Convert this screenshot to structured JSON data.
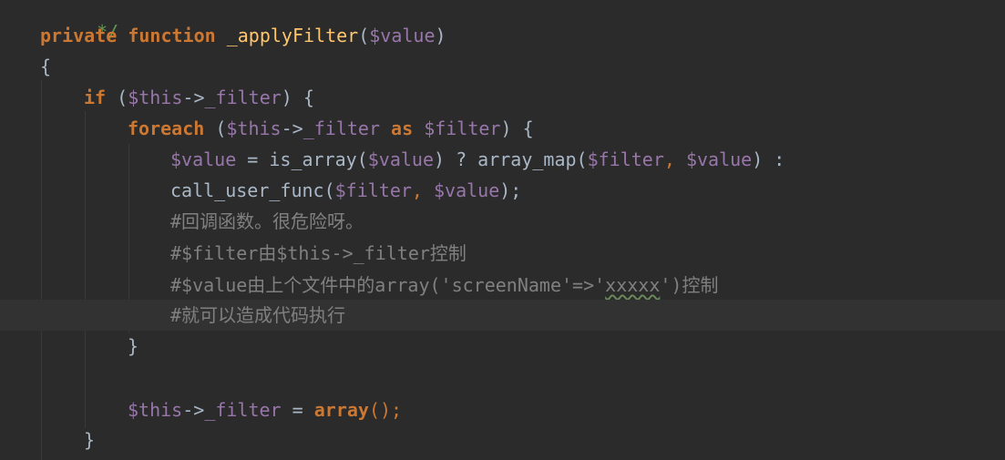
{
  "code": {
    "line0_doc_end": "*/",
    "line1": {
      "kw_private": "private",
      "kw_function": "function",
      "fn_name": "_applyFilter",
      "paren_open": "(",
      "param": "$value",
      "paren_close": ")"
    },
    "line2_brace": "{",
    "line3": {
      "kw_if": "if",
      "p1": "(",
      "this": "$this",
      "arrow": "->",
      "prop": "_filter",
      "p2": ") {"
    },
    "line4": {
      "kw_foreach": "foreach",
      "p1": "(",
      "this": "$this",
      "arrow": "->",
      "prop": "_filter",
      "kw_as": "as",
      "var": "$filter",
      "p2": ") {"
    },
    "line5": {
      "var1": "$value",
      "eq": " = is_array(",
      "var2": "$value",
      "mid": ") ? array_map(",
      "var3": "$filter",
      "comma": ", ",
      "var4": "$value",
      "end": ") :"
    },
    "line6": {
      "fn": "call_user_func(",
      "var1": "$filter",
      "comma": ", ",
      "var2": "$value",
      "end": ");"
    },
    "line7_comment": "#回调函数。很危险呀。",
    "line8_comment": "#$filter由$this->_filter控制",
    "line9": {
      "c1": "#$value由上个文件中的array('screenName'=>'",
      "squiggly": "xxxxx",
      "c2": "')控制"
    },
    "line10_comment": "#就可以造成代码执行",
    "line11_brace": "}",
    "line13": {
      "this": "$this",
      "arrow": "->",
      "prop": "_filter",
      "eq": " = ",
      "kw_array": "array",
      "end": "();"
    },
    "line14_brace": "}"
  },
  "colors": {
    "background": "#2b2b2b",
    "current_line": "#323232",
    "keyword": "#cc7832",
    "function_name": "#ffc66d",
    "variable": "#9876aa",
    "comment": "#808080",
    "doc_comment": "#629755",
    "text": "#a9b7c6"
  }
}
